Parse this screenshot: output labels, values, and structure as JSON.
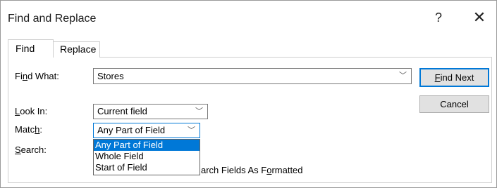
{
  "window": {
    "title": "Find and Replace",
    "help": "?",
    "close": "✕"
  },
  "tabs": [
    {
      "label": "Find"
    },
    {
      "label": "Replace"
    }
  ],
  "find_what": {
    "label_pre": "Fi",
    "label_u": "n",
    "label_post": "d What:",
    "value": "Stores"
  },
  "look_in": {
    "label_u": "L",
    "label_post": "ook In:",
    "value": "Current field"
  },
  "match": {
    "label_pre": "Matc",
    "label_u": "h",
    "label_post": ":",
    "value": "Any Part of Field",
    "options": [
      "Any Part of Field",
      "Whole Field",
      "Start of Field"
    ]
  },
  "search": {
    "label_u": "S",
    "label_post": "earch:"
  },
  "search_formatted": {
    "pre": "arch Fields As F",
    "u": "o",
    "post": "rmatted"
  },
  "buttons": {
    "find_next_u": "F",
    "find_next_post": "ind Next",
    "cancel": "Cancel"
  },
  "icons": {
    "chevron": "﹀"
  }
}
